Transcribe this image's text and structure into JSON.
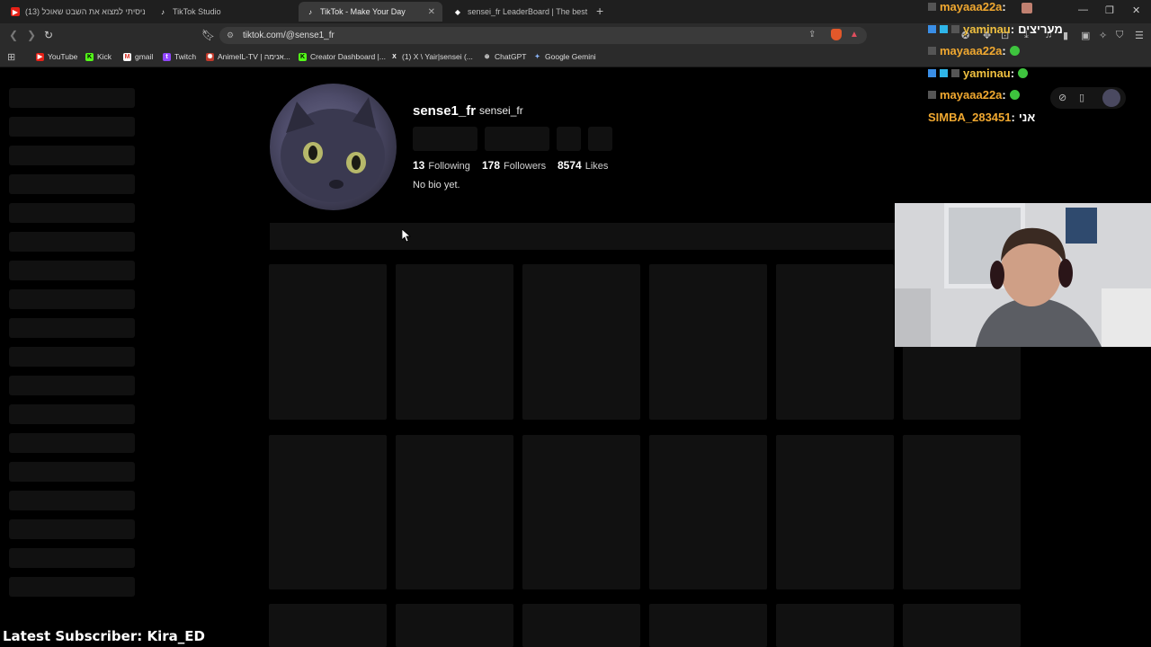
{
  "tabs": [
    {
      "label": "ניסיתי למצוא את השבט שאוכל (13)",
      "icon": "youtube-icon"
    },
    {
      "label": "TikTok Studio",
      "icon": "tiktok-icon"
    },
    {
      "label": "TikTok - Make Your Day",
      "icon": "tiktok-icon"
    },
    {
      "label": "sensei_fr LeaderBoard | The best Cha",
      "icon": "site-icon"
    }
  ],
  "address": {
    "url": "tiktok.com/@sense1_fr"
  },
  "bookmarks": [
    {
      "label": "YouTube"
    },
    {
      "label": "Kick"
    },
    {
      "label": "gmail"
    },
    {
      "label": "Twitch"
    },
    {
      "label": "AnimeIL-TV | אנימה..."
    },
    {
      "label": "Creator Dashboard |..."
    },
    {
      "label": "(1) X \\ Yair|sensei (..."
    },
    {
      "label": "ChatGPT"
    },
    {
      "label": "Google Gemini"
    }
  ],
  "profile": {
    "username": "sense1_fr",
    "nickname": "sensei_fr",
    "following": "13",
    "following_label": "Following",
    "followers": "178",
    "followers_label": "Followers",
    "likes": "8574",
    "likes_label": "Likes",
    "bio": "No bio yet."
  },
  "chat": [
    {
      "user": "mayaaa22a",
      "sep": " :"
    },
    {
      "user": "yaminau",
      "sep": " :",
      "text": "מעריצים"
    },
    {
      "user": "mayaaa22a",
      "sep": " :"
    },
    {
      "user": "yaminau",
      "sep": " :"
    },
    {
      "user": "mayaaa22a",
      "sep": " :"
    },
    {
      "user": "SIMBA_283451",
      "sep": " :",
      "text": "אני"
    }
  ],
  "overlay": {
    "latest_subscriber": "Latest Subscriber: Kira_ED"
  },
  "colors": {
    "chat_user": "#f0a830",
    "skeleton": "#111111",
    "accent": "#3ec43e"
  }
}
